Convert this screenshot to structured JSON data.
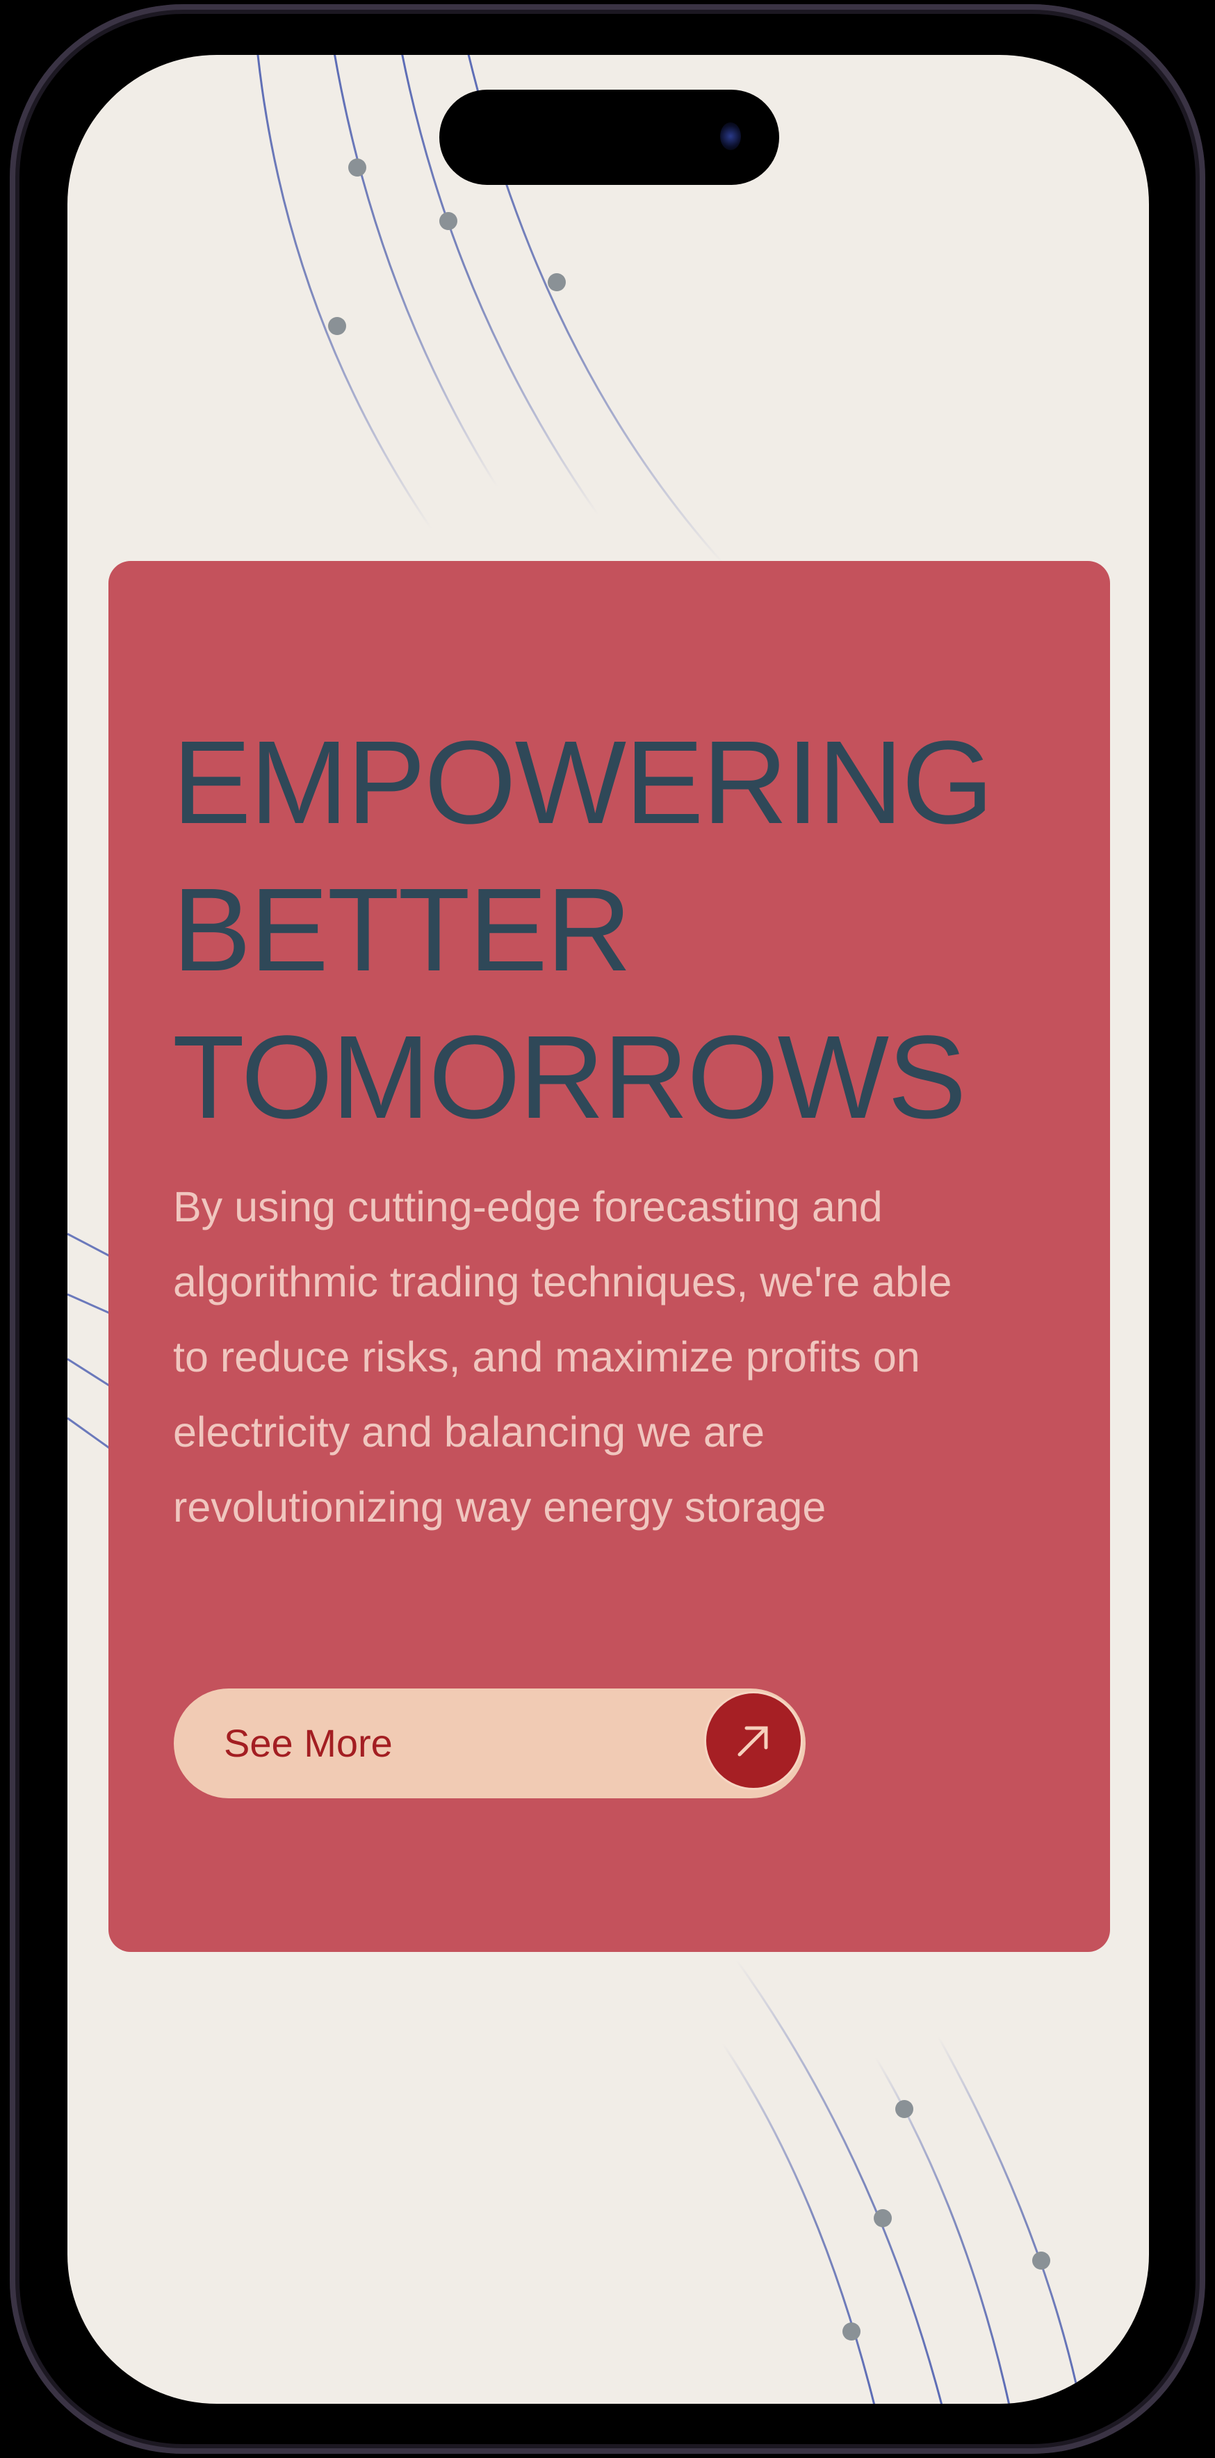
{
  "hero": {
    "title_lines": [
      "EMPOWERING",
      "BETTER",
      "TOMORROWS"
    ],
    "description": "By using cutting-edge forecasting and algorithmic trading techniques, we're able to reduce risks, and maximize profits on electricity and balancing we are revolutionizing way energy storage",
    "cta_label": "See More",
    "cta_icon": "arrow-up-right-icon"
  },
  "colors": {
    "background": "#f1ede7",
    "card": "#c4525c",
    "title": "#2f4858",
    "description": "#f0c6bf",
    "button": "#f1cbb4",
    "button_accent": "#a61f24",
    "lines": "#5b6bb5",
    "dots": "#8a9196"
  }
}
